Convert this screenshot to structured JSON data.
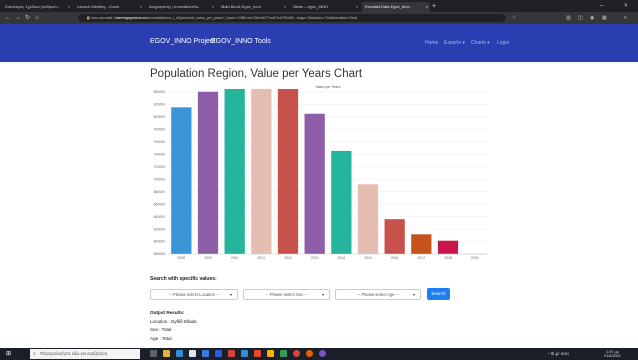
{
  "browser": {
    "tabs": [
      {
        "title": "Κατάλογος Σχεδίων (ανθρωπ...",
        "active": false
      },
      {
        "title": "Launch Meeting - Zoom",
        "active": false
      },
      {
        "title": "Διαχειριστής | InnovationHu...",
        "active": false
      },
      {
        "title": "Main Block Egov_Inno",
        "active": false
      },
      {
        "title": "News – egov_INNO",
        "active": false
      },
      {
        "title": "Eurostat Data Egov_Inno",
        "active": true
      }
    ],
    "new_tab": "+",
    "address": {
      "prefix": "inno.eurostat / ",
      "host": "interregegovinno.eu",
      "path": "/eurostat/demo_r_d2jan/chart_value_per_years?_token=V3BKmkYDhHnkT7mdl7tr4cFEuBb...&age=Total&sex=Total&location=Total"
    }
  },
  "site": {
    "brand_project": "EGOV_INNO Project",
    "brand_tools": "EGOV_INNO Tools",
    "nav": [
      "Home",
      "Exports ▾",
      "Charts ▾",
      "Login"
    ]
  },
  "page": {
    "title": "Population Region, Value per Years Chart",
    "search_heading": "Search with specific values:",
    "selects": [
      {
        "value": "-- Please select Location --"
      },
      {
        "value": "-- Please select Sex --"
      },
      {
        "value": "-- Please select Age --"
      }
    ],
    "search_button": "Search",
    "output": {
      "heading": "Output Results:",
      "lines": [
        "Location : Eyθίδ Ellada",
        "Sex : Total",
        "Age : Total"
      ]
    }
  },
  "chart_data": {
    "type": "bar",
    "legend": "Value per Years",
    "categories": [
      "2008",
      "2009",
      "2010",
      "2011",
      "2012",
      "2013",
      "2014",
      "2015",
      "2016",
      "2017",
      "2018",
      "2019"
    ],
    "values": [
      11060000,
      11094000,
      11119000,
      11123000,
      11104000,
      11046000,
      10965000,
      10892000,
      10816000,
      10783000,
      10769000,
      10741000
    ],
    "colors": [
      "#3a96d6",
      "#8e5ea8",
      "#24b59c",
      "#e6bdb1",
      "#c9514b",
      "#8e5ea8",
      "#24b59c",
      "#e6bdb1",
      "#c9514b",
      "#c8521b",
      "#c8174c",
      "#e6bdb1"
    ],
    "ylim": [
      10740000,
      11100000
    ],
    "yticks": [
      "840000",
      "820000",
      "800000",
      "780000",
      "760000",
      "740000",
      "720000",
      "700000",
      "680000",
      "660000",
      "640000",
      "620000",
      "600000",
      "580000"
    ],
    "grid": true
  },
  "taskbar": {
    "search_placeholder": "Πληκτρολογήστε εδώ για αναζήτηση",
    "tray": "^  ⊞  🔊  ENG",
    "time": "1:57 μμ",
    "date": "21/4/2021"
  }
}
